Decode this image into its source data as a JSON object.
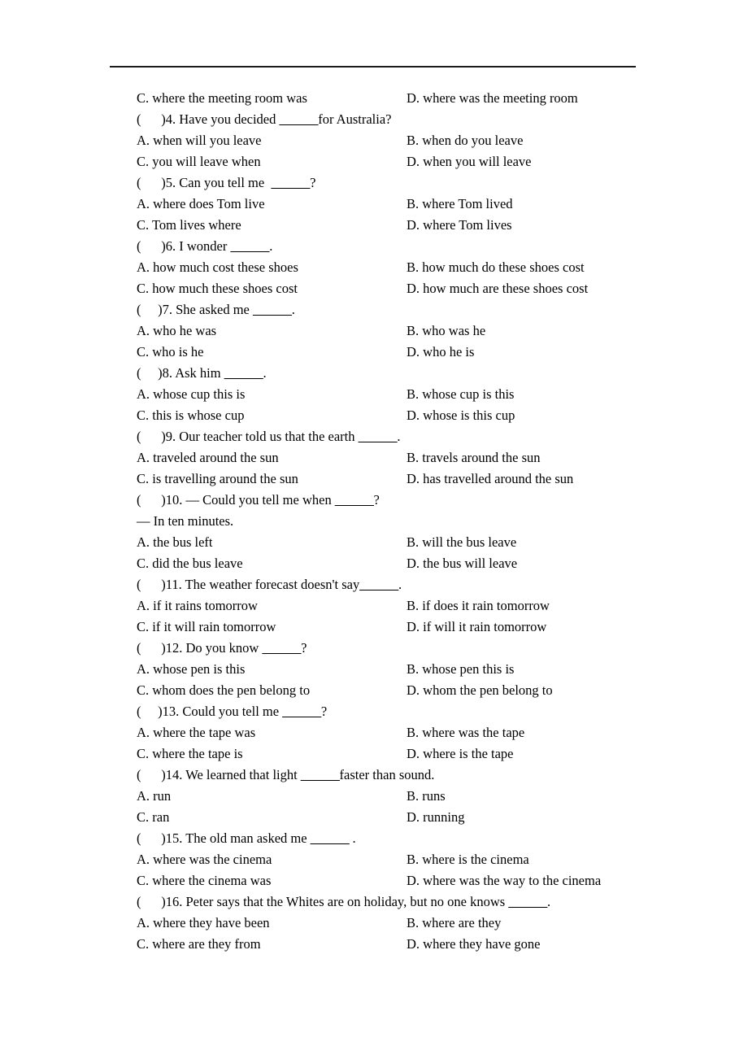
{
  "document": {
    "type": "exam-worksheet",
    "subject": "English grammar multiple choice — indirect/reported questions",
    "top_rule": true,
    "blank_mark": "______"
  },
  "orphan_options": {
    "left": "C. where the meeting room was",
    "right": "D. where was the meeting room"
  },
  "questions": [
    {
      "marker": "(      )",
      "number": "4.",
      "stem": " Have you decided ",
      "blank": "______",
      "stem_tail": "for Australia?",
      "dialogue_line": "",
      "options": {
        "A": "A. when will you leave",
        "B": "B. when do you leave",
        "C": "C. you will leave when",
        "D": "D. when you will leave"
      }
    },
    {
      "marker": "(      )",
      "number": "5.",
      "stem": " Can you tell me  ",
      "blank": "______",
      "stem_tail": "?",
      "dialogue_line": "",
      "options": {
        "A": "A. where does Tom live",
        "B": "B. where Tom lived",
        "C": "C. Tom lives where",
        "D": "D. where Tom lives"
      }
    },
    {
      "marker": "(      )",
      "number": "6.",
      "stem": " I wonder ",
      "blank": "______",
      "stem_tail": ".",
      "dialogue_line": "",
      "options": {
        "A": "A. how much cost these shoes",
        "B": "B. how much do these shoes cost",
        "C": "C. how much these shoes cost",
        "D": "D. how much are these shoes cost"
      }
    },
    {
      "marker": "(     )",
      "number": "7.",
      "stem": " She asked me ",
      "blank": "______",
      "stem_tail": ".",
      "dialogue_line": "",
      "options": {
        "A": "A. who he was",
        "B": "B. who was he",
        "C": "C. who is he",
        "D": "D. who he is"
      }
    },
    {
      "marker": "(     )",
      "number": "8.",
      "stem": " Ask him ",
      "blank": "______",
      "stem_tail": ".",
      "dialogue_line": "",
      "options": {
        "A": "A. whose cup this is",
        "B": "B. whose cup is this",
        "C": "C. this is whose cup",
        "D": "D. whose is this cup"
      }
    },
    {
      "marker": "(      )",
      "number": "9.",
      "stem": " Our teacher told us that the earth ",
      "blank": "______",
      "stem_tail": ".",
      "dialogue_line": "",
      "options": {
        "A": "A. traveled around the sun",
        "B": "B. travels around the sun",
        "C": "C. is travelling around the sun",
        "D": "D. has travelled around the sun"
      }
    },
    {
      "marker": "(      )",
      "number": "10.",
      "stem": " — Could you tell me when ",
      "blank": "______",
      "stem_tail": "?",
      "dialogue_line": "— In ten minutes.",
      "options": {
        "A": "A. the bus left",
        "B": "B. will the bus leave",
        "C": "C. did the bus leave",
        "D": "D. the bus will leave"
      }
    },
    {
      "marker": "(      )",
      "number": "11.",
      "stem": " The weather forecast doesn't say",
      "blank": "______",
      "stem_tail": ".",
      "dialogue_line": "",
      "options": {
        "A": "A. if it rains tomorrow",
        "B": "B. if does it rain tomorrow",
        "C": "C. if it will rain tomorrow",
        "D": "D. if will it rain tomorrow"
      }
    },
    {
      "marker": "(      )",
      "number": "12.",
      "stem": " Do you know ",
      "blank": "______",
      "stem_tail": "?",
      "dialogue_line": "",
      "options": {
        "A": "A. whose pen is this",
        "B": "B. whose pen this is",
        "C": "C. whom does the pen belong to",
        "D": "D. whom the pen belong to"
      }
    },
    {
      "marker": "(     )",
      "number": "13.",
      "stem": " Could you tell me ",
      "blank": "______",
      "stem_tail": "?",
      "dialogue_line": "",
      "options": {
        "A": "A. where the tape was",
        "B": "B. where was the tape",
        "C": "C. where the tape is",
        "D": "D. where is the tape"
      }
    },
    {
      "marker": "(      )",
      "number": "14.",
      "stem": " We learned that light ",
      "blank": "______",
      "stem_tail": "faster than sound.",
      "dialogue_line": "",
      "options": {
        "A": "A. run",
        "B": "B. runs",
        "C": "C. ran",
        "D": "D. running"
      }
    },
    {
      "marker": "(      )",
      "number": "15.",
      "stem": " The old man asked me ",
      "blank": "______",
      "stem_tail": " .",
      "dialogue_line": "",
      "options": {
        "A": "A. where was the cinema",
        "B": "B. where is the cinema",
        "C": "C. where the cinema was",
        "D": "D. where was the way to the cinema"
      }
    },
    {
      "marker": "(      )",
      "number": "16.",
      "stem": " Peter says that the Whites are on holiday, but no one knows ",
      "blank": "______",
      "stem_tail": ".",
      "dialogue_line": "",
      "options": {
        "A": "A. where they have been",
        "B": "B. where are they",
        "C": "C. where are they from",
        "D": "D. where they have gone"
      }
    }
  ]
}
